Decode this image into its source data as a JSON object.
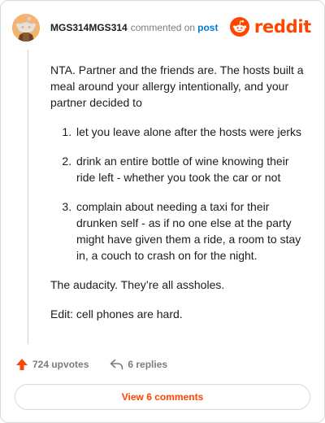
{
  "comment": {
    "author": "MGS314MGS314",
    "action_text": "commented on",
    "post_link": "post"
  },
  "brand": {
    "wordmark": "reddit",
    "color": "#ff4500"
  },
  "body": {
    "intro": "NTA. Partner and the friends are. The hosts built a meal around your allergy intentionally, and your partner decided to",
    "list": [
      "let you leave alone after the hosts were jerks",
      "drink an entire bottle of wine knowing their ride left - whether you took the car or not",
      "complain about needing a taxi for their drunken self - as if no one else at the party might have given them a ride, a room to stay in, a couch to crash on for the night."
    ],
    "outro": "The audacity. They’re all assholes.",
    "edit": "Edit: cell phones are hard."
  },
  "actions": {
    "upvotes": "724 upvotes",
    "replies": "6 replies",
    "upvote_icon": "upvote-arrow-icon",
    "reply_icon": "reply-arrow-icon"
  },
  "footer": {
    "view_comments": "View 6 comments"
  },
  "colors": {
    "accent": "#ff4500",
    "link": "#0079d3",
    "muted": "#7c7c7c",
    "border": "#d9d9d9"
  }
}
